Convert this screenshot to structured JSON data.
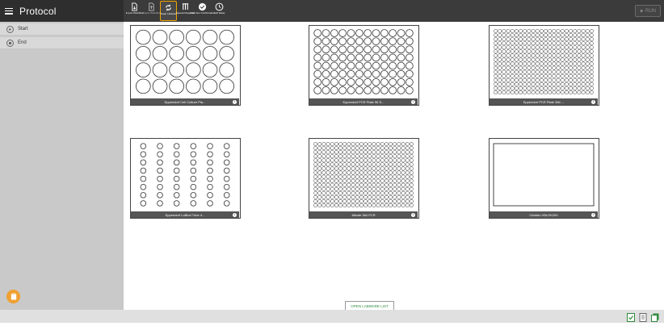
{
  "app": {
    "title": "Protocol"
  },
  "toolbar": {
    "items": [
      {
        "label": "Import Workflow",
        "icon": "import-file-icon"
      },
      {
        "label": "Export Workflow",
        "icon": "export-file-icon"
      },
      {
        "label": "Swap Labware",
        "icon": "swap-arrows-icon"
      },
      {
        "label": "Spread Dispense",
        "icon": "multi-channel-icon"
      },
      {
        "label": "Add User Confirmation",
        "icon": "check-circle-icon"
      },
      {
        "label": "Add Delay",
        "icon": "clock-icon"
      }
    ],
    "run_label": "RUN"
  },
  "sidebar": {
    "steps": [
      {
        "label": "Start",
        "icon": "play-icon"
      },
      {
        "label": "End",
        "icon": "stop-icon"
      }
    ]
  },
  "labware": [
    {
      "name": "Eppendorf Cell Culture Pla...",
      "rows": 4,
      "cols": 6,
      "kind": "wells"
    },
    {
      "name": "Eppendorf PCR Plate 96 S...",
      "rows": 8,
      "cols": 12,
      "kind": "wells"
    },
    {
      "name": "Eppendorf PCR Plate 384 ...",
      "rows": 16,
      "cols": 24,
      "kind": "wells"
    },
    {
      "name": "Eppendorf LoBind Tube 4...",
      "rows": 8,
      "cols": 6,
      "kind": "tubes"
    },
    {
      "name": "4titude 384 PCR",
      "rows": 16,
      "cols": 24,
      "kind": "wells"
    },
    {
      "name": "Clickbio VBLOK200",
      "rows": 0,
      "cols": 0,
      "kind": "reservoir"
    }
  ],
  "footer": {
    "open_list_label": "OPEN LABWARE LIST"
  },
  "colors": {
    "accent": "#f0a500",
    "topbar": "#3b3b3b",
    "sidebar": "#c9c9c9",
    "link_green": "#2e8b3d"
  }
}
